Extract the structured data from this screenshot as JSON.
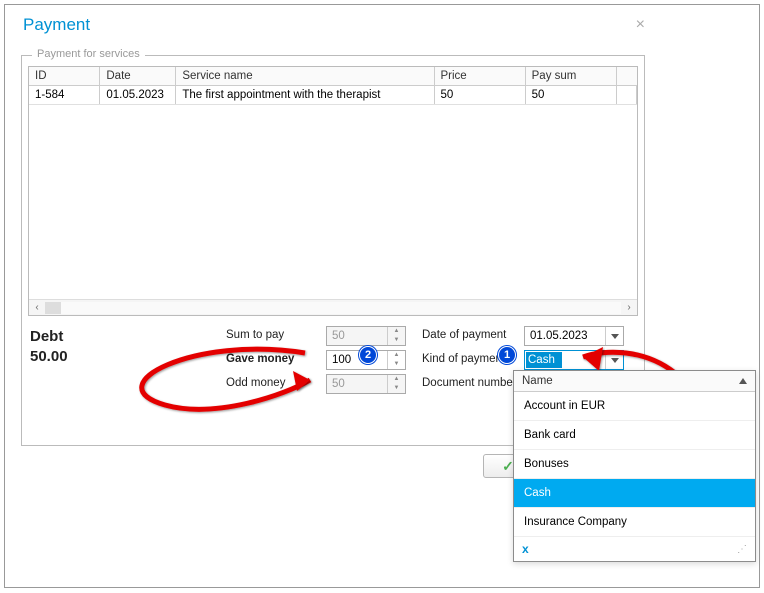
{
  "dialog": {
    "title": "Payment",
    "close": "×"
  },
  "fieldset_legend": "Payment for services",
  "table": {
    "headers": {
      "id": "ID",
      "date": "Date",
      "svc": "Service name",
      "price": "Price",
      "pay": "Pay sum"
    },
    "row": {
      "id": "1-584",
      "date": "01.05.2023",
      "svc": "The first appointment with the therapist",
      "price": "50",
      "pay": "50"
    }
  },
  "debt": {
    "label": "Debt",
    "value": "50.00"
  },
  "labels": {
    "sum_to_pay": "Sum to pay",
    "gave_money": "Gave money",
    "odd_money": "Odd money",
    "date_of_payment": "Date of payment",
    "kind_of_payment": "Kind of payment",
    "document_number": "Document number"
  },
  "values": {
    "sum_to_pay": "50",
    "gave_money": "100",
    "odd_money": "50",
    "date_of_payment": "01.05.2023",
    "kind_of_payment": "Cash"
  },
  "dropdown": {
    "header": "Name",
    "items": [
      "Account in EUR",
      "Bank card",
      "Bonuses",
      "Cash",
      "Insurance Company"
    ],
    "selected": "Cash",
    "clear": "x"
  },
  "scroll": {
    "left": "‹",
    "right": "›"
  },
  "badges": {
    "b1": "1",
    "b2": "2"
  }
}
